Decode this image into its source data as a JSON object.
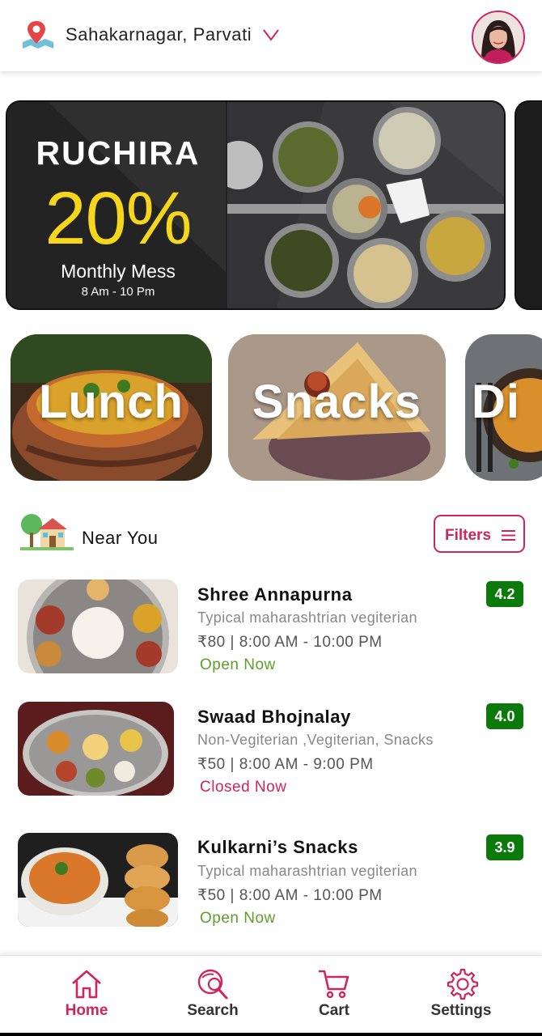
{
  "header": {
    "location": "Sahakarnagar, Parvati",
    "location_icon": "map-pin-icon",
    "chevron_icon": "chevron-down-icon"
  },
  "banner": {
    "brand": "RUCHIRA",
    "discount": "20%",
    "subtitle": "Monthly Mess",
    "hours": "8 Am - 10 Pm"
  },
  "categories": [
    {
      "label": "Lunch"
    },
    {
      "label": "Snacks"
    },
    {
      "label": "Di"
    }
  ],
  "near_you": {
    "title": "Near You",
    "filters_label": "Filters"
  },
  "restaurants": [
    {
      "name": "Shree Annapurna",
      "description": "Typical maharashtrian vegiterian",
      "price_hours": "₹80 | 8:00 AM - 10:00 PM",
      "status": "Open Now",
      "rating": "4.2"
    },
    {
      "name": "Swaad Bhojnalay",
      "description": "Non-Vegiterian ,Vegiterian, Snacks",
      "price_hours": "₹50 | 8:00 AM - 9:00 PM",
      "status": "Closed Now",
      "rating": "4.0"
    },
    {
      "name": "Kulkarni’s Snacks",
      "description": "Typical maharashtrian vegiterian",
      "price_hours": "₹50 | 8:00 AM - 10:00 PM",
      "status": "Open Now",
      "rating": "3.9"
    }
  ],
  "nav": {
    "items": [
      {
        "label": "Home",
        "icon": "home-icon",
        "active": true
      },
      {
        "label": "Search",
        "icon": "search-icon",
        "active": false
      },
      {
        "label": "Cart",
        "icon": "cart-icon",
        "active": false
      },
      {
        "label": "Settings",
        "icon": "gear-icon",
        "active": false
      }
    ]
  },
  "colors": {
    "accent": "#d0245e",
    "open": "#5f9e2a",
    "rating_bg": "#0b7a0b",
    "banner_yellow": "#f5d61a"
  }
}
